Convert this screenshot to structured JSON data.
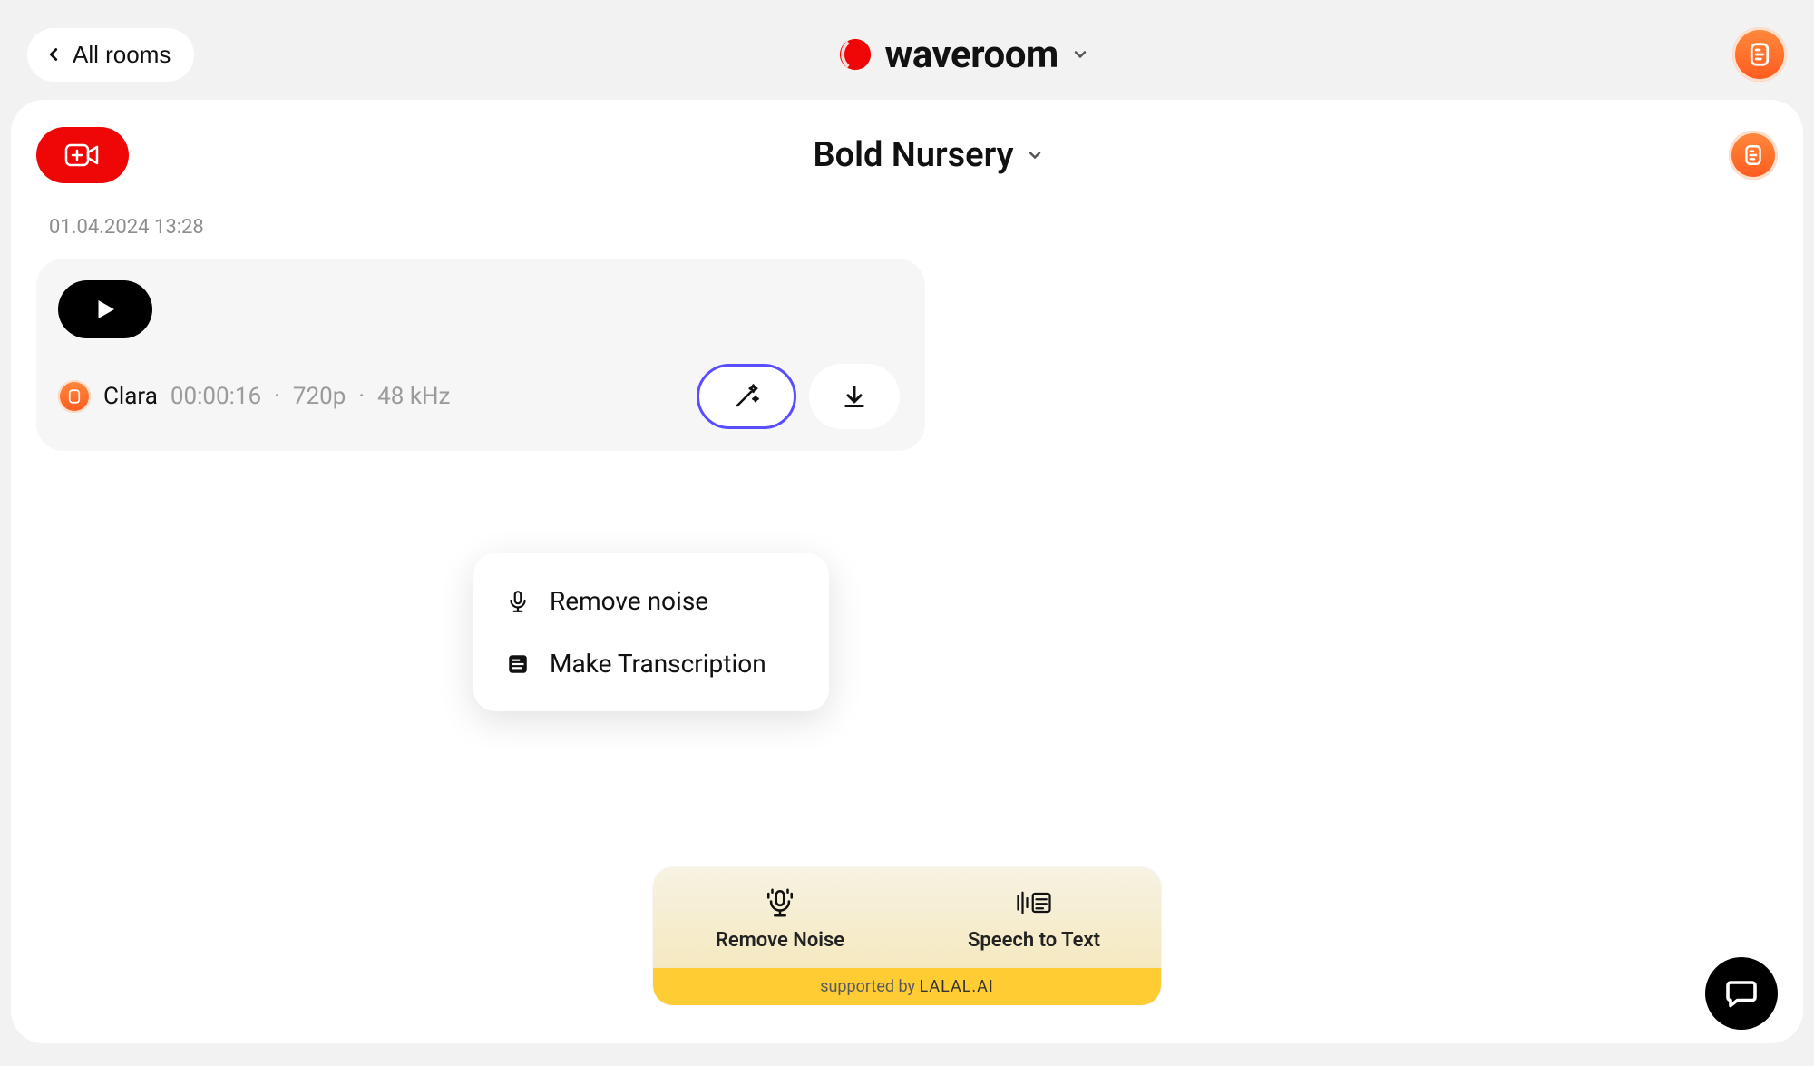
{
  "header": {
    "all_rooms": "All rooms",
    "brand": "waveroom"
  },
  "room": {
    "title": "Bold Nursery",
    "timestamp": "01.04.2024 13:28"
  },
  "clip": {
    "name": "Clara",
    "duration": "00:00:16",
    "resolution": "720p",
    "samplerate": "48 kHz"
  },
  "dropdown": {
    "remove_noise": "Remove noise",
    "make_transcription": "Make Transcription"
  },
  "toolbar": {
    "remove_noise": "Remove Noise",
    "speech_to_text": "Speech to Text",
    "supported_by": "supported by ",
    "supported_brand": "LALAL.AI"
  }
}
